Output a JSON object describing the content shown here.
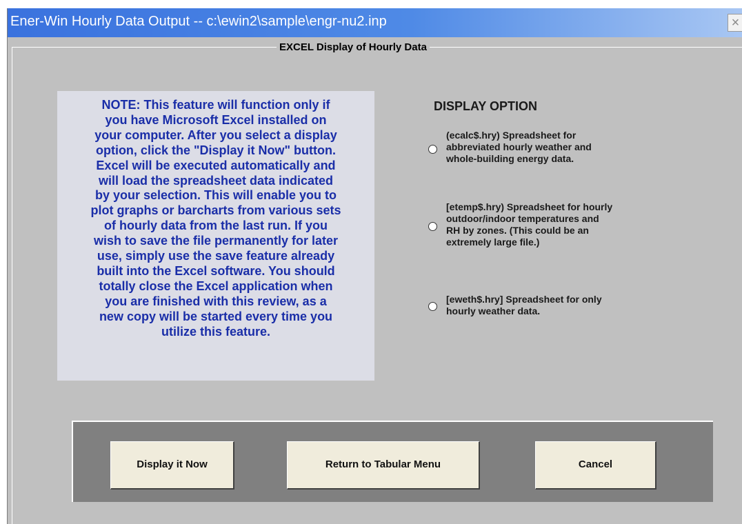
{
  "window": {
    "title": "Ener-Win Hourly Data Output -- c:\\ewin2\\sample\\engr-nu2.inp",
    "close_glyph": "×",
    "group_title": "EXCEL Display of Hourly Data"
  },
  "note": {
    "lines": [
      "NOTE:  This feature will function only if",
      "you have Microsoft Excel installed on",
      "your computer.  After you select a display",
      "option, click the \"Display it Now\" button.",
      "Excel will be executed automatically and",
      "will load the spreadsheet data indicated",
      "by your selection.  This will enable you to",
      "plot graphs or barcharts from various sets",
      "of hourly data from the last run.  If you",
      "wish to save the file permanently for later",
      "use, simply use the save feature already",
      "built into the Excel software.  You should",
      "totally close the Excel application when",
      "you are finished with this review, as a",
      "new copy will be started every time you",
      "utilize this feature."
    ]
  },
  "display_option": {
    "heading": "DISPLAY OPTION",
    "options": [
      {
        "lines": [
          "(ecalc$.hry)  Spreadsheet for",
          "abbreviated hourly weather and",
          "whole-building energy data."
        ],
        "selected": false
      },
      {
        "lines": [
          "[etemp$.hry)  Spreadsheet for hourly",
          "outdoor/indoor temperatures and",
          "RH by zones.  (This could be an",
          "extremely large file.)"
        ],
        "selected": false
      },
      {
        "lines": [
          "[eweth$.hry] Spreadsheet for only",
          "hourly weather data."
        ],
        "selected": false
      }
    ]
  },
  "buttons": {
    "display_now": "Display it Now",
    "return_menu": "Return to Tabular Menu",
    "cancel": "Cancel"
  },
  "colors": {
    "titlebar_start": "#3a72de",
    "titlebar_end": "#a9c7f3",
    "dialog_bg": "#c0c0c0",
    "note_bg": "#dcdde6",
    "note_text": "#1a2ea8",
    "button_panel": "#808080",
    "button_face": "#f0ecdc"
  }
}
